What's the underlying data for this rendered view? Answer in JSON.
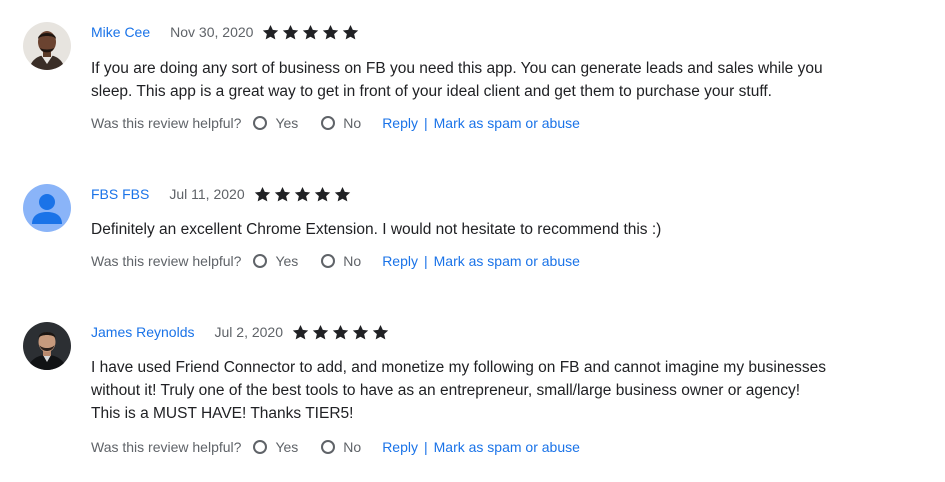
{
  "reviews": [
    {
      "author": "Mike Cee",
      "date": "Nov 30, 2020",
      "rating": 5,
      "lines": [
        "If you are doing any sort of business on FB you need this app.  You can generate leads and sales while you",
        "sleep.  This app is a great way to get in front of your ideal client and get them to purchase your stuff."
      ]
    },
    {
      "author": "FBS FBS",
      "date": "Jul 11, 2020",
      "rating": 5,
      "lines": [
        "Definitely an excellent Chrome Extension. I would not hesitate to recommend this :)"
      ]
    },
    {
      "author": "James Reynolds",
      "date": "Jul 2, 2020",
      "rating": 5,
      "lines": [
        "I have used Friend Connector to add, and monetize my following on FB and cannot imagine my businesses",
        "without it! Truly one of the best tools to have as an entrepreneur, small/large business owner or agency!",
        "This is a MUST HAVE! Thanks TIER5!"
      ]
    }
  ],
  "helpful": {
    "question": "Was this review helpful?",
    "yes": "Yes",
    "no": "No",
    "reply": "Reply",
    "separator": "|",
    "spam": "Mark as spam or abuse"
  },
  "icons": {
    "star": "star-icon",
    "radio": "radio-icon",
    "avatar_placeholder": "person-icon"
  },
  "colors": {
    "link": "#1a73e8",
    "star": "#202124",
    "avatar_placeholder_bg": "#8ab4f8",
    "avatar_placeholder_fg": "#1a73e8"
  }
}
